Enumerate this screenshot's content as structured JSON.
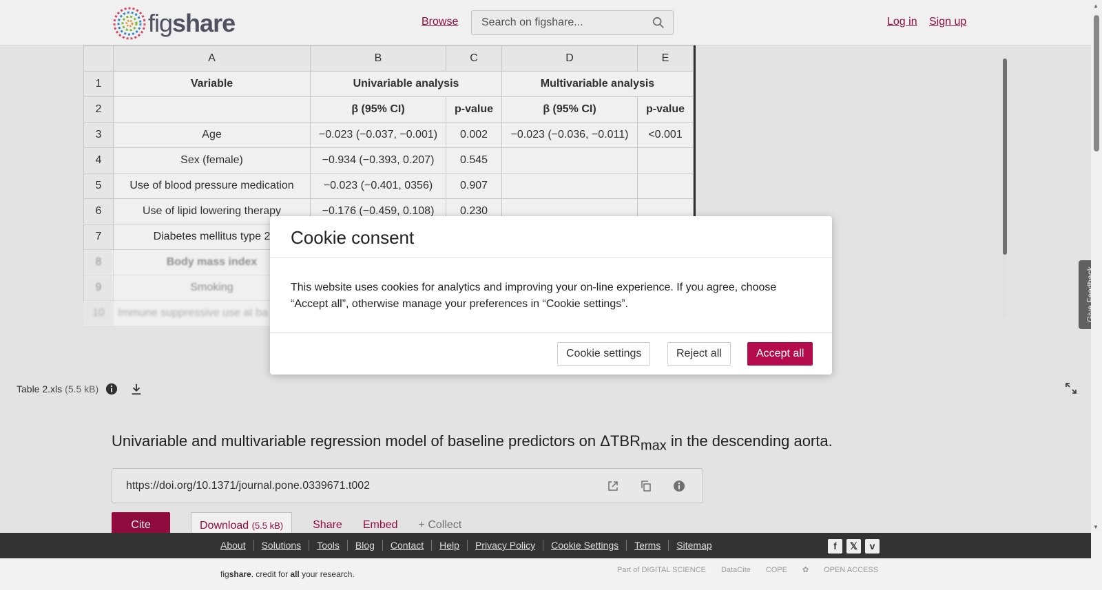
{
  "header": {
    "logo_text_light": "fig",
    "logo_text_bold": "share",
    "browse": "Browse",
    "search_placeholder": "Search on figshare...",
    "login": "Log in",
    "signup": "Sign up"
  },
  "sheet": {
    "columns": [
      "A",
      "B",
      "C",
      "D",
      "E"
    ],
    "rows": [
      {
        "num": "1",
        "cells": [
          "Variable",
          "Univariable analysis",
          "",
          "Multivariable analysis",
          ""
        ]
      },
      {
        "num": "2",
        "cells": [
          "",
          "β (95% CI)",
          "p-value",
          "β (95% CI)",
          "p-value"
        ]
      },
      {
        "num": "3",
        "cells": [
          "Age",
          "−0.023 (−0.037, −0.001)",
          "0.002",
          "−0.023 (−0.036, −0.011)",
          "<0.001"
        ]
      },
      {
        "num": "4",
        "cells": [
          "Sex (female)",
          "−0.934 (−0.393, 0.207)",
          "0.545",
          "",
          ""
        ]
      },
      {
        "num": "5",
        "cells": [
          "Use of blood pressure medication",
          "−0.023 (−0.401, 0356)",
          "0.907",
          "",
          ""
        ]
      },
      {
        "num": "6",
        "cells": [
          "Use of lipid lowering therapy",
          "−0.176 (−0.459, 0.108)",
          "0.230",
          "",
          ""
        ]
      },
      {
        "num": "7",
        "cells": [
          "Diabetes mellitus type 2",
          "",
          "",
          "",
          ""
        ]
      },
      {
        "num": "8",
        "cells": [
          "Body mass index",
          "",
          "",
          "",
          ""
        ]
      },
      {
        "num": "9",
        "cells": [
          "Smoking",
          "",
          "",
          "",
          ""
        ]
      },
      {
        "num": "10",
        "cells": [
          "Immune suppressive use at ba",
          "",
          "",
          "",
          ""
        ]
      }
    ]
  },
  "feedback": "Give Feedback",
  "file": {
    "name": "Table 2.xls",
    "size": "(5.5 kB)"
  },
  "item": {
    "title_main": "Univariable and multivariable regression model of baseline predictors on ΔTBR",
    "title_sub": "max",
    "title_end": " in the descending aorta.",
    "doi": "https://doi.org/10.1371/journal.pone.0339671.t002"
  },
  "actions": {
    "cite": "Cite",
    "download": "Download",
    "download_size": "(5.5 kB)",
    "share": "Share",
    "embed": "Embed",
    "collect": "+ Collect"
  },
  "footer": {
    "links": [
      "About",
      "Solutions",
      "Tools",
      "Blog",
      "Contact",
      "Help",
      "Privacy Policy",
      "Cookie Settings",
      "Terms",
      "Sitemap"
    ],
    "tagline_pre": "fig",
    "tagline_bold": "share",
    "tagline_mid": ". credit for ",
    "tagline_all": "all",
    "tagline_end": " your research.",
    "partners": [
      "Part of DIGITAL SCIENCE",
      "DataCite",
      "COPE",
      "✿",
      "OPEN ACCESS"
    ]
  },
  "cookie": {
    "title": "Cookie consent",
    "body": "This website uses cookies for analytics and improving your on-line experience. If you agree, choose “Accept all”, otherwise manage your preferences in “Cookie settings”.",
    "settings": "Cookie settings",
    "reject": "Reject all",
    "accept": "Accept all"
  },
  "colors": {
    "brand": "#9b0d42",
    "accept": "#b30b4c"
  }
}
